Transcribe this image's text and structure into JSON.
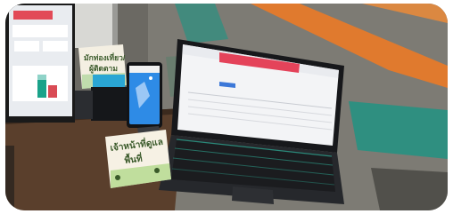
{
  "scene": {
    "type": "photo",
    "subjects": [
      "laptop",
      "smartphone",
      "desktop-monitor",
      "tent-card-signs",
      "carpet"
    ]
  },
  "monitor": {
    "accent": "#e24a57",
    "chart_colors": [
      "#1aa28a",
      "#d94b55",
      "#8fd3c8"
    ]
  },
  "laptop": {
    "screen_banner_color": "#e4435a",
    "button_color": "#3c78d8",
    "keyboard_color": "#1b1c1f"
  },
  "phone": {
    "screen_color": "#2e8be6"
  },
  "sign_back": {
    "line1": "มักท่องเที่ยว/",
    "line2": "ผู้ติดตาม"
  },
  "sign_front": {
    "line1": "เจ้าหน้าที่ดูแล",
    "line2": "พื้นที่"
  },
  "carpet": {
    "colors": [
      "#4b4a46",
      "#e07a2e",
      "#2f8f80",
      "#8c8a83"
    ]
  }
}
